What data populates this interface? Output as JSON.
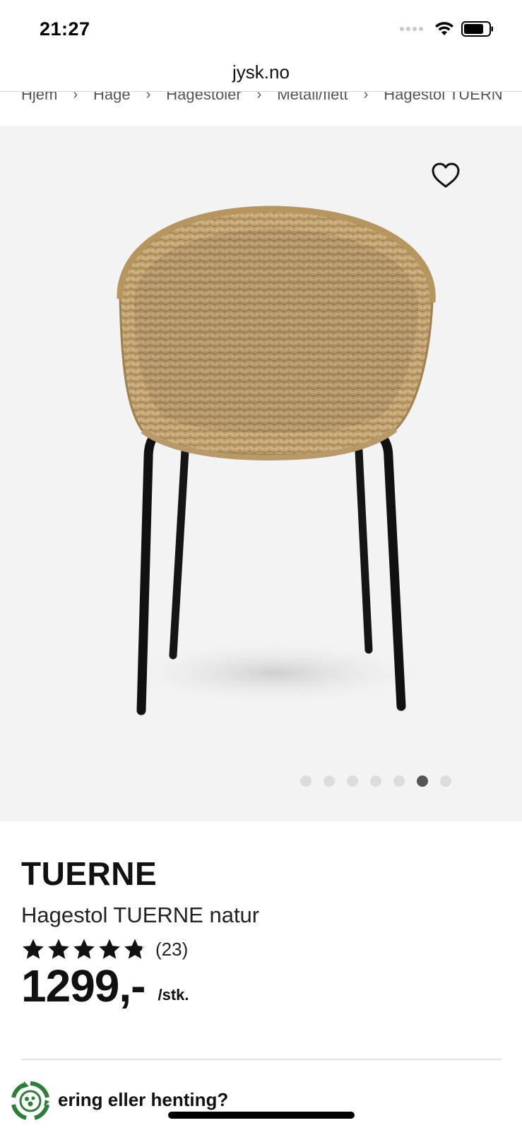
{
  "status_bar": {
    "time": "21:27",
    "icons": [
      "signal-icon",
      "wifi-icon",
      "battery-icon"
    ]
  },
  "browser": {
    "url": "jysk.no"
  },
  "breadcrumb": {
    "items": [
      "Hjem",
      "Hage",
      "Hagestoler",
      "Metall/flett",
      "Hagestol TUERNE"
    ],
    "separator": "›"
  },
  "gallery": {
    "image_count": 7,
    "active_index": 5,
    "favorite_icon": "heart-outline-icon"
  },
  "product": {
    "brand": "TUERNE",
    "name": "Hagestol TUERNE natur",
    "rating": 4.8,
    "rating_max": 5,
    "review_count": "(23)",
    "price": "1299,-",
    "unit": "/stk."
  },
  "delivery": {
    "question": "ering eller henting?",
    "icon": "delivery-recycle-icon"
  },
  "colors": {
    "gallery_background": "#f3f3f3",
    "text": "#111111",
    "dot_inactive": "#dcdcdc",
    "dot_active": "#555555",
    "delivery_icon_green": "#2e7d3a"
  }
}
